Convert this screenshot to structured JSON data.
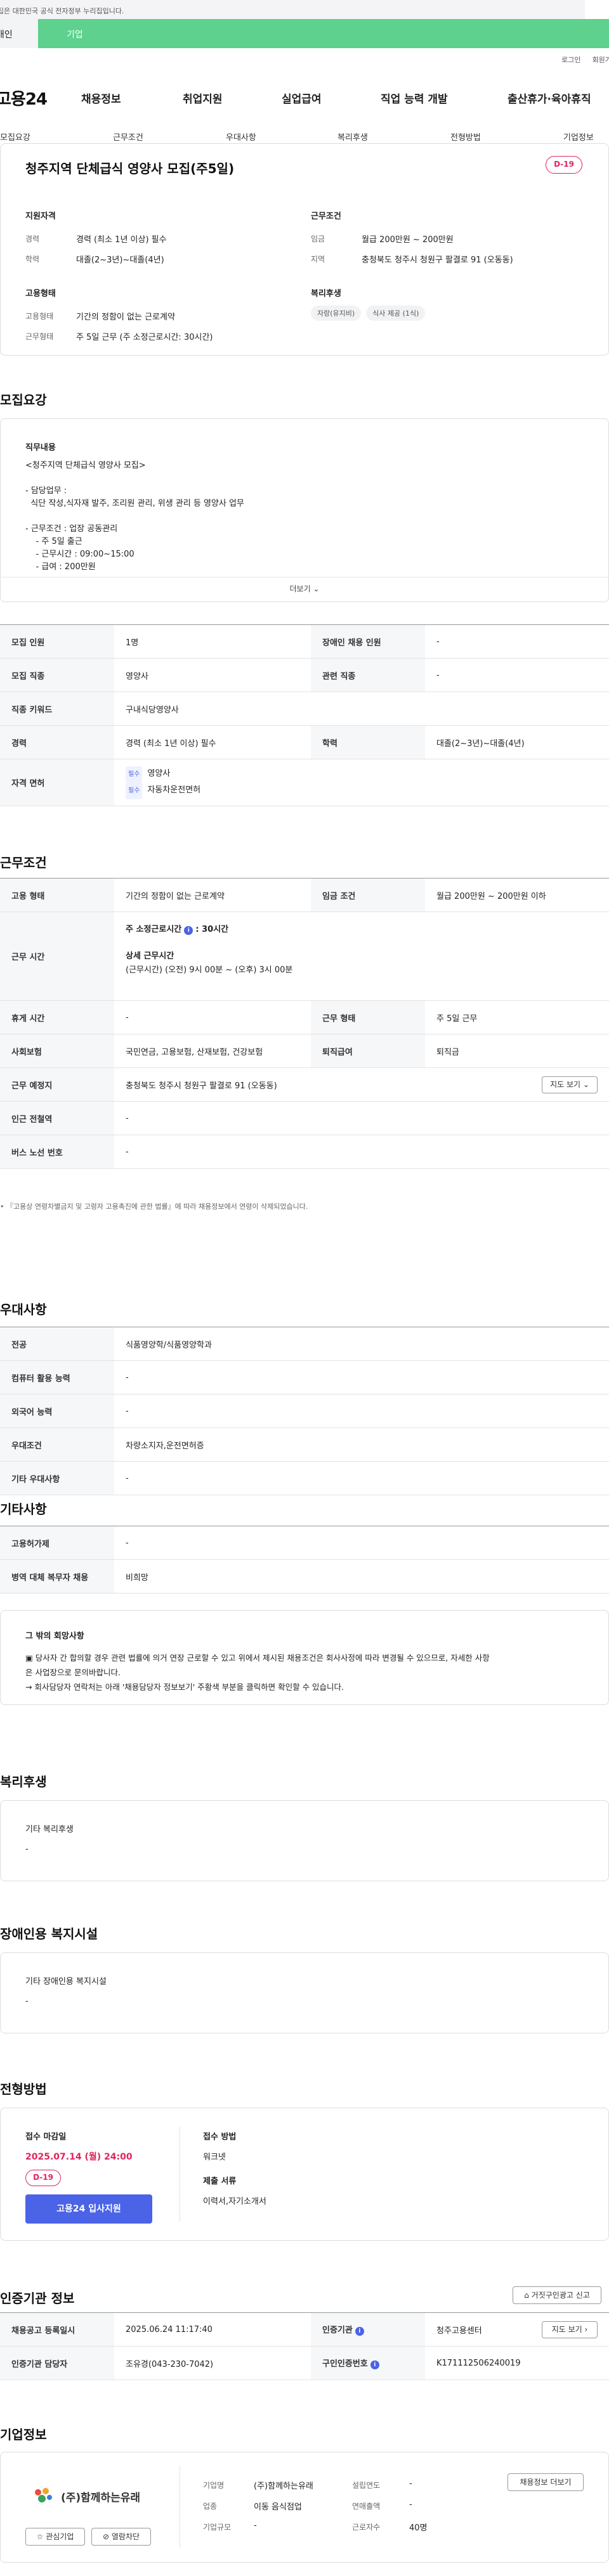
{
  "gov_banner": "이 누리집은 대한민국 공식 전자정부 누리집입니다.",
  "persona_tabs": {
    "left": "개인",
    "right": "기업"
  },
  "util_links": [
    "로그인",
    "회원가입"
  ],
  "logo": "고용24",
  "gnb": [
    "채용정보",
    "취업지원",
    "실업급여",
    "직업 능력 개발",
    "출산휴가·육아휴직"
  ],
  "subnav": [
    "모집요강",
    "근무조건",
    "우대사항",
    "복리후생",
    "전형방법",
    "기업정보"
  ],
  "summary": {
    "title": "청주지역 단체급식 영양사 모집(주5일)",
    "dday": "D-19",
    "qual_heading": "지원자격",
    "qual": [
      {
        "label": "경력",
        "value": "경력 (최소 1년 이상) 필수"
      },
      {
        "label": "학력",
        "value": "대졸(2~3년)~대졸(4년)"
      }
    ],
    "cond_heading": "근무조건",
    "cond": [
      {
        "label": "임금",
        "value": "월급 200만원 ~ 200만원"
      },
      {
        "label": "지역",
        "value": "충청북도 청주시 청원구 팔결로 91 (오동동)"
      }
    ],
    "emp_heading": "고용형태",
    "emp": [
      {
        "label": "고용형태",
        "value": "기간의 정함이 없는 근로계약"
      },
      {
        "label": "근무형태",
        "value": "주 5일 근무 (주 소정근로시간: 30시간)"
      }
    ],
    "welfare_heading": "복리후생",
    "welfare_chips": [
      "자랑(유지비)",
      "식사 제공 (1식)"
    ]
  },
  "recruit": {
    "heading": "모집요강",
    "job_heading": "직무내용",
    "job_text": "<청주지역 단체급식 영양사 모집>\n\n- 담당업무 :\n  식단 작성,식자재 발주, 조리원 관리, 위생 관리 등 영양사 업무\n\n- 근무조건 : 업장 공동관리\n    - 주 5일 출근\n    - 근무시간 : 09:00~15:00\n    - 급여 : 200만원",
    "more": "더보기",
    "rows": [
      {
        "th1": "모집 인원",
        "td1": "1명",
        "th2": "장애인 채용 인원",
        "td2": "-"
      },
      {
        "th1": "모집 직종",
        "td1": "영양사",
        "th2": "관련 직종",
        "td2": "-"
      },
      {
        "th1": "직종 키워드",
        "td1": "구내식당영양사"
      },
      {
        "th1": "경력",
        "td1": "경력 (최소 1년 이상) 필수",
        "th2": "학력",
        "td2": "대졸(2~3년)~대졸(4년)"
      }
    ],
    "license_th": "자격 면허",
    "licenses": [
      {
        "badge": "필수",
        "name": "영양사"
      },
      {
        "badge": "필수",
        "name": "자동차운전면허"
      }
    ]
  },
  "work": {
    "heading": "근무조건",
    "r1": {
      "th1": "고용 형태",
      "td1": "기간의 정함이 없는 근로계약",
      "th2": "임금 조건",
      "td2": "월급 200만원 ~ 200만원 이하"
    },
    "hours_th": "근무 시간",
    "hours_label": "주 소정근로시간",
    "hours_value": ": 30시간",
    "detail_label": "상세 근무시간",
    "detail_value": "(근무시간) (오전) 9시 00분 ~ (오후) 3시 00분",
    "r3": {
      "th1": "휴게 시간",
      "td1": "-",
      "th2": "근무 형태",
      "td2": "주 5일 근무"
    },
    "r4": {
      "th1": "사회보험",
      "td1": "국민연금, 고용보험, 산재보험, 건강보험",
      "th2": "퇴직급여",
      "td2": "퇴직금"
    },
    "r5": {
      "th1": "근무 예정지",
      "td1": "충청북도 청주시 청원구 팔결로 91 (오동동)",
      "btn": "지도 보기"
    },
    "r6": {
      "th1": "인근 전철역",
      "td1": "-"
    },
    "r7": {
      "th1": "버스 노선 번호",
      "td1": "-"
    },
    "note": "『고용상 연령차별금지 및 고령자 고용촉진에 관한 법률』에 따라 채용정보에서 연령이 삭제되었습니다."
  },
  "pref": {
    "heading": "우대사항",
    "rows": [
      {
        "th": "전공",
        "td": "식품영양학/식품영양학과"
      },
      {
        "th": "컴퓨터 활용 능력",
        "td": "-"
      },
      {
        "th": "외국어 능력",
        "td": "-"
      },
      {
        "th": "우대조건",
        "td": "차량소지자,운전면허증"
      },
      {
        "th": "기타 우대사항",
        "td": "-"
      }
    ]
  },
  "other": {
    "heading": "기타사항",
    "rows": [
      {
        "th": "고용허가제",
        "td": "-"
      },
      {
        "th": "병역 대체 복무자 채용",
        "td": "비희망"
      }
    ],
    "box_title": "그 밖의 회망사항",
    "box_lines": [
      "▣ 당사자 간 합의할 경우 관련 법률에 의거 연장 근로할 수 있고 위에서 제시된 채용조건은 회사사정에 따라 변경될 수 있으므로, 자세한 사항",
      "은 사업장으로 문의바랍니다.",
      "→ 회사담당자 연락처는 아래 '채용담당자 정보보기' 주황색 부분을 클릭하면 확인할 수 있습니다."
    ]
  },
  "welfare": {
    "heading": "복리후생",
    "box_title": "기타 복리후생",
    "box_value": "-"
  },
  "disab": {
    "heading": "장애인용 복지시설",
    "box_title": "기타 장애인용 복지시설",
    "box_value": "-"
  },
  "screen": {
    "heading": "전형방법",
    "deadline_label": "접수 마감일",
    "deadline": "2025.07.14 (월) 24:00",
    "dday": "D-19",
    "apply_btn": "고용24 입사지원",
    "method_label": "접수 방법",
    "method": "워크넷",
    "docs_label": "제출 서류",
    "docs": "이력서,자기소개서"
  },
  "agency": {
    "heading": "인증기관 정보",
    "report_btn": "거짓구인광고 신고",
    "r1": {
      "th1": "채용공고 등록일시",
      "td1": "2025.06.24 11:17:40",
      "th2": "인증기관",
      "td2": "청주고용센터",
      "btn": "지도 보기"
    },
    "r2": {
      "th1": "인증기관 담당자",
      "td1": "조유경(043-230-7042)",
      "th2": "구인인증번호",
      "td2": "K171112506240019"
    }
  },
  "company": {
    "heading": "기업정보",
    "logo_text": "(주)함께하는유래",
    "fav_btn": "관심기업",
    "block_btn": "열람차단",
    "rows": [
      {
        "th1": "기업명",
        "td1": "(주)함께하는유래",
        "th2": "설립연도",
        "td2": "-"
      },
      {
        "th1": "업종",
        "td1": "이동 음식점업",
        "th2": "연매출액",
        "td2": "-"
      },
      {
        "th1": "기업규모",
        "td1": "-",
        "th2": "근로자수",
        "td2": "40명"
      }
    ],
    "info_btn": "채용정보 더보기"
  }
}
